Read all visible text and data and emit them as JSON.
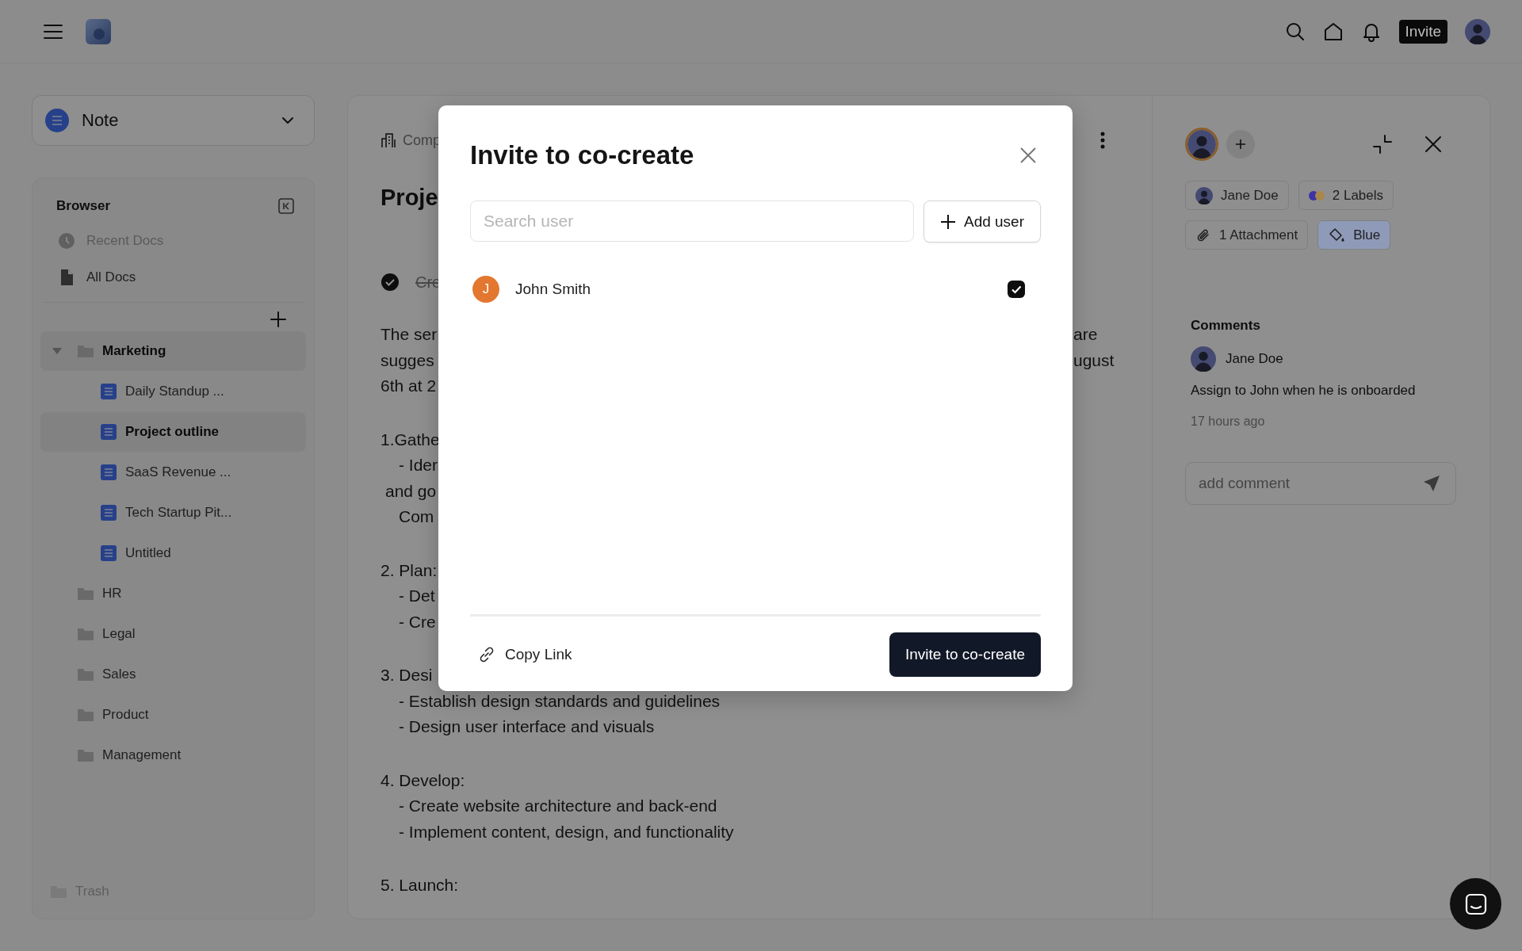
{
  "top_bar": {
    "invite_button": "Invite"
  },
  "workspace_switcher": {
    "label": "Note"
  },
  "browser": {
    "title": "Browser",
    "nav": [
      {
        "kind": "recent",
        "label": "Recent Docs",
        "disabled": true
      },
      {
        "kind": "all",
        "label": "All Docs",
        "disabled": false
      }
    ],
    "tree": [
      {
        "kind": "folder",
        "label": "Marketing",
        "expanded": true,
        "children": [
          {
            "kind": "doc",
            "label": "Daily Standup ...",
            "selected": false
          },
          {
            "kind": "doc",
            "label": "Project outline",
            "selected": true
          },
          {
            "kind": "doc",
            "label": "SaaS Revenue ...",
            "selected": false
          },
          {
            "kind": "doc",
            "label": "Tech Startup Pit...",
            "selected": false
          },
          {
            "kind": "doc",
            "label": "Untitled",
            "selected": false
          }
        ]
      },
      {
        "kind": "folder",
        "label": "HR",
        "expanded": false
      },
      {
        "kind": "folder",
        "label": "Legal",
        "expanded": false
      },
      {
        "kind": "folder",
        "label": "Sales",
        "expanded": false
      },
      {
        "kind": "folder",
        "label": "Product",
        "expanded": false
      },
      {
        "kind": "folder",
        "label": "Management",
        "expanded": false
      }
    ],
    "trash": {
      "label": "Trash"
    }
  },
  "document": {
    "breadcrumb": "Comp",
    "title": "Proje",
    "task": {
      "text": "Cre",
      "done": true
    },
    "blocks": [
      [
        {
          "kind": "text",
          "left": "The ser",
          "right": "are"
        },
        {
          "kind": "text",
          "left": "sugges",
          "right": "ugust"
        },
        {
          "kind": "text",
          "left": "6th at 2"
        }
      ],
      [
        {
          "kind": "text",
          "left": "1.Gathe"
        },
        {
          "kind": "bullet",
          "left": "- Ider"
        },
        {
          "kind": "cont",
          "left": "and go"
        },
        {
          "kind": "bullet",
          "left": "Com"
        }
      ],
      [
        {
          "kind": "text",
          "left": "2. Plan:"
        },
        {
          "kind": "bullet",
          "left": "- Det"
        },
        {
          "kind": "bullet",
          "left": "- Cre"
        }
      ],
      [
        {
          "kind": "text",
          "left": "3. Desi"
        },
        {
          "kind": "bullet",
          "left": "- Establish design standards and guidelines"
        },
        {
          "kind": "bullet",
          "left": "- Design user interface and visuals"
        }
      ],
      [
        {
          "kind": "text",
          "left": "4. Develop:"
        },
        {
          "kind": "bullet",
          "left": "- Create website architecture and back-end"
        },
        {
          "kind": "bullet",
          "left": "- Implement content, design, and functionality"
        }
      ],
      [
        {
          "kind": "text",
          "left": "5. Launch:"
        }
      ]
    ]
  },
  "details": {
    "chips": [
      {
        "kind": "assignee",
        "label": "Jane Doe"
      },
      {
        "kind": "labels",
        "label": "2 Labels",
        "dots": [
          {
            "color": "#3c33a6"
          },
          {
            "color": "#a9864c"
          }
        ]
      },
      {
        "kind": "attachment",
        "label": "1 Attachment"
      },
      {
        "kind": "color",
        "label": "Blue",
        "color": "#8e9ab8"
      }
    ],
    "comments": {
      "title": "Comments",
      "items": [
        {
          "author": "Jane Doe",
          "text": "Assign to John when he is onboarded",
          "time": "17 hours ago"
        }
      ]
    },
    "comment_field": {
      "placeholder": "add comment"
    }
  },
  "modal": {
    "title": "Invite to co-create",
    "search": {
      "placeholder": "Search user"
    },
    "add_button": "Add user",
    "users": [
      {
        "initial": "J",
        "name": "John Smith",
        "checked": true
      }
    ],
    "copy_link": "Copy Link",
    "submit": "Invite to co-create"
  }
}
